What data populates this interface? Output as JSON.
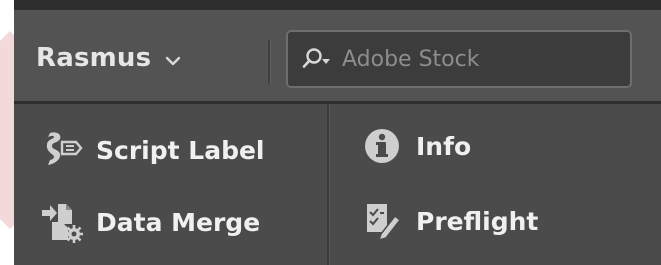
{
  "header": {
    "user_name": "Rasmus",
    "search": {
      "placeholder": "Adobe Stock",
      "value": ""
    }
  },
  "menu": {
    "items": [
      {
        "label": "Script Label",
        "icon": "script-label-icon"
      },
      {
        "label": "Data Merge",
        "icon": "data-merge-icon"
      },
      {
        "label": "Info",
        "icon": "info-icon"
      },
      {
        "label": "Preflight",
        "icon": "preflight-icon"
      }
    ]
  },
  "colors": {
    "panel_bg": "#4b4b4b",
    "topbar_bg": "#535353",
    "text": "#f0f0f0",
    "accent_deco": "#f3d9da"
  }
}
